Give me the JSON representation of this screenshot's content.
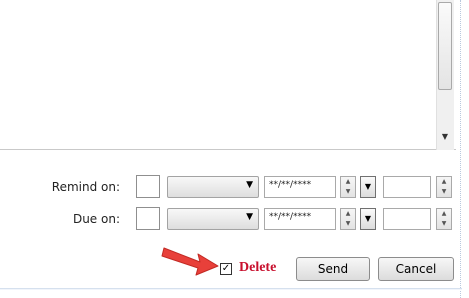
{
  "reminder": {
    "remind_on_label": "Remind on:",
    "due_on_label": "Due on:",
    "date_placeholder": "**/**/****"
  },
  "actions": {
    "delete_label": "Delete",
    "delete_checked": true,
    "send_label": "Send",
    "cancel_label": "Cancel"
  },
  "icons": {
    "scroll_down": "triangle-down-icon",
    "dropdown": "chevron-down-icon",
    "spinner": "spin-arrows-icon",
    "pointer": "red-arrow-icon",
    "check": "checkmark-icon"
  },
  "colors": {
    "delete_text": "#c8102e",
    "pointer_arrow": "#e8403a"
  }
}
